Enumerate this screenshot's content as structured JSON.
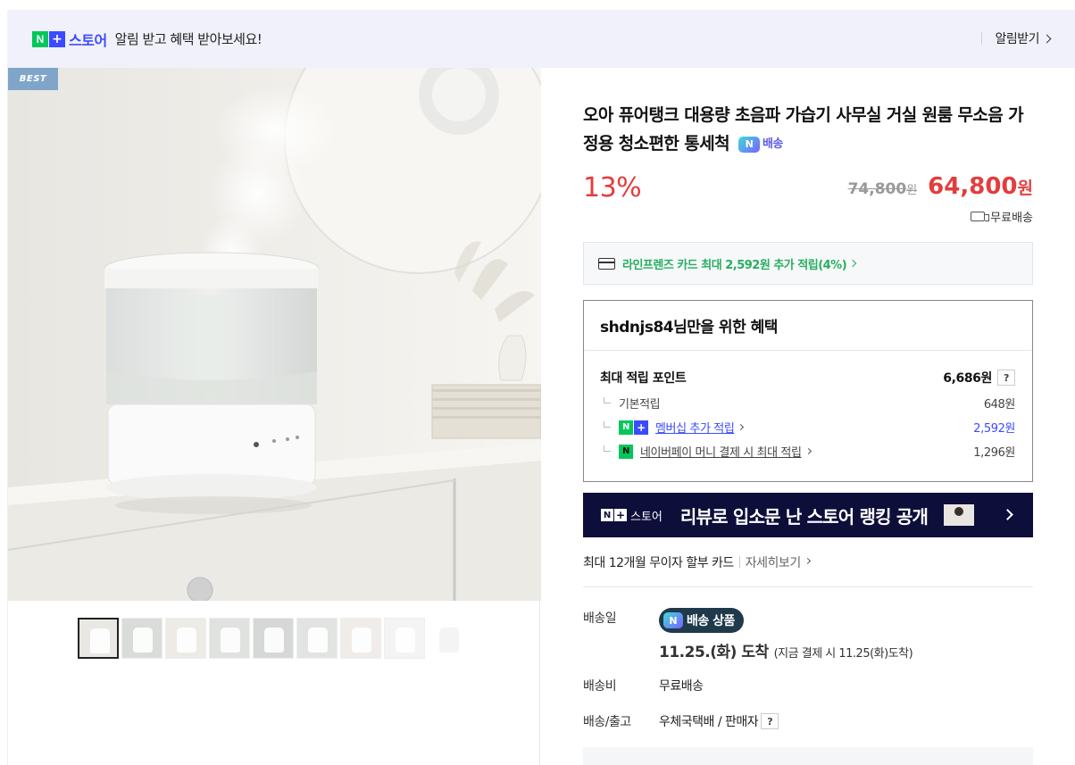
{
  "notice": {
    "store_n": "N",
    "store_plus": "+",
    "store_name": "스토어",
    "message": "알림 받고 혜택 받아보세요!",
    "action": "알림받기"
  },
  "gallery": {
    "badge": "BEST",
    "thumbnail_count": 9,
    "active_thumbnail": 1
  },
  "product": {
    "title": "오아 퓨어탱크 대용량 초음파 가습기 사무실 거실 원룸 무소음 가정용 청소편한 통세척",
    "delivery_badge_icon": "N",
    "delivery_badge": "배송",
    "discount": "13%",
    "original_price": "74,800",
    "original_unit": "원",
    "sale_price": "64,800",
    "sale_unit": "원",
    "shipping": "무료배송"
  },
  "card_benefit": {
    "text": "라인프렌즈 카드 최대 2,592원 추가 적립(4%)"
  },
  "benefit": {
    "title": "shdnjs84님만을 위한 혜택",
    "max_label": "최대 적립 포인트",
    "max_value": "6,686원",
    "help": "?",
    "rows": [
      {
        "label": "기본적립",
        "value": "648원"
      },
      {
        "label": "멤버십 추가 적립",
        "value": "2,592원"
      },
      {
        "label": "네이버페이 머니 결제 시 최대 적립",
        "value": "1,296원"
      }
    ]
  },
  "banner": {
    "store": "스토어",
    "text": "리뷰로 입소문 난 스토어 랭킹 공개"
  },
  "installment": {
    "text": "최대 12개월 무이자 할부 카드",
    "more": "자세히보기"
  },
  "delivery": {
    "date_label": "배송일",
    "chip_icon": "N",
    "chip_text": "배송 상품",
    "arrival_main": "11.25.(화) 도착",
    "arrival_sub": "(지금 결제 시 11.25(화)도착)",
    "fee_label": "배송비",
    "fee_value": "무료배송",
    "ship_label": "배송/출고",
    "ship_value": "우체국택배 / 판매자",
    "help": "?"
  },
  "colors": {
    "accent_red": "#e33d3d",
    "naver_green": "#03c75a",
    "plus_blue": "#3b4bff",
    "banner_navy": "#0d0e3a"
  }
}
